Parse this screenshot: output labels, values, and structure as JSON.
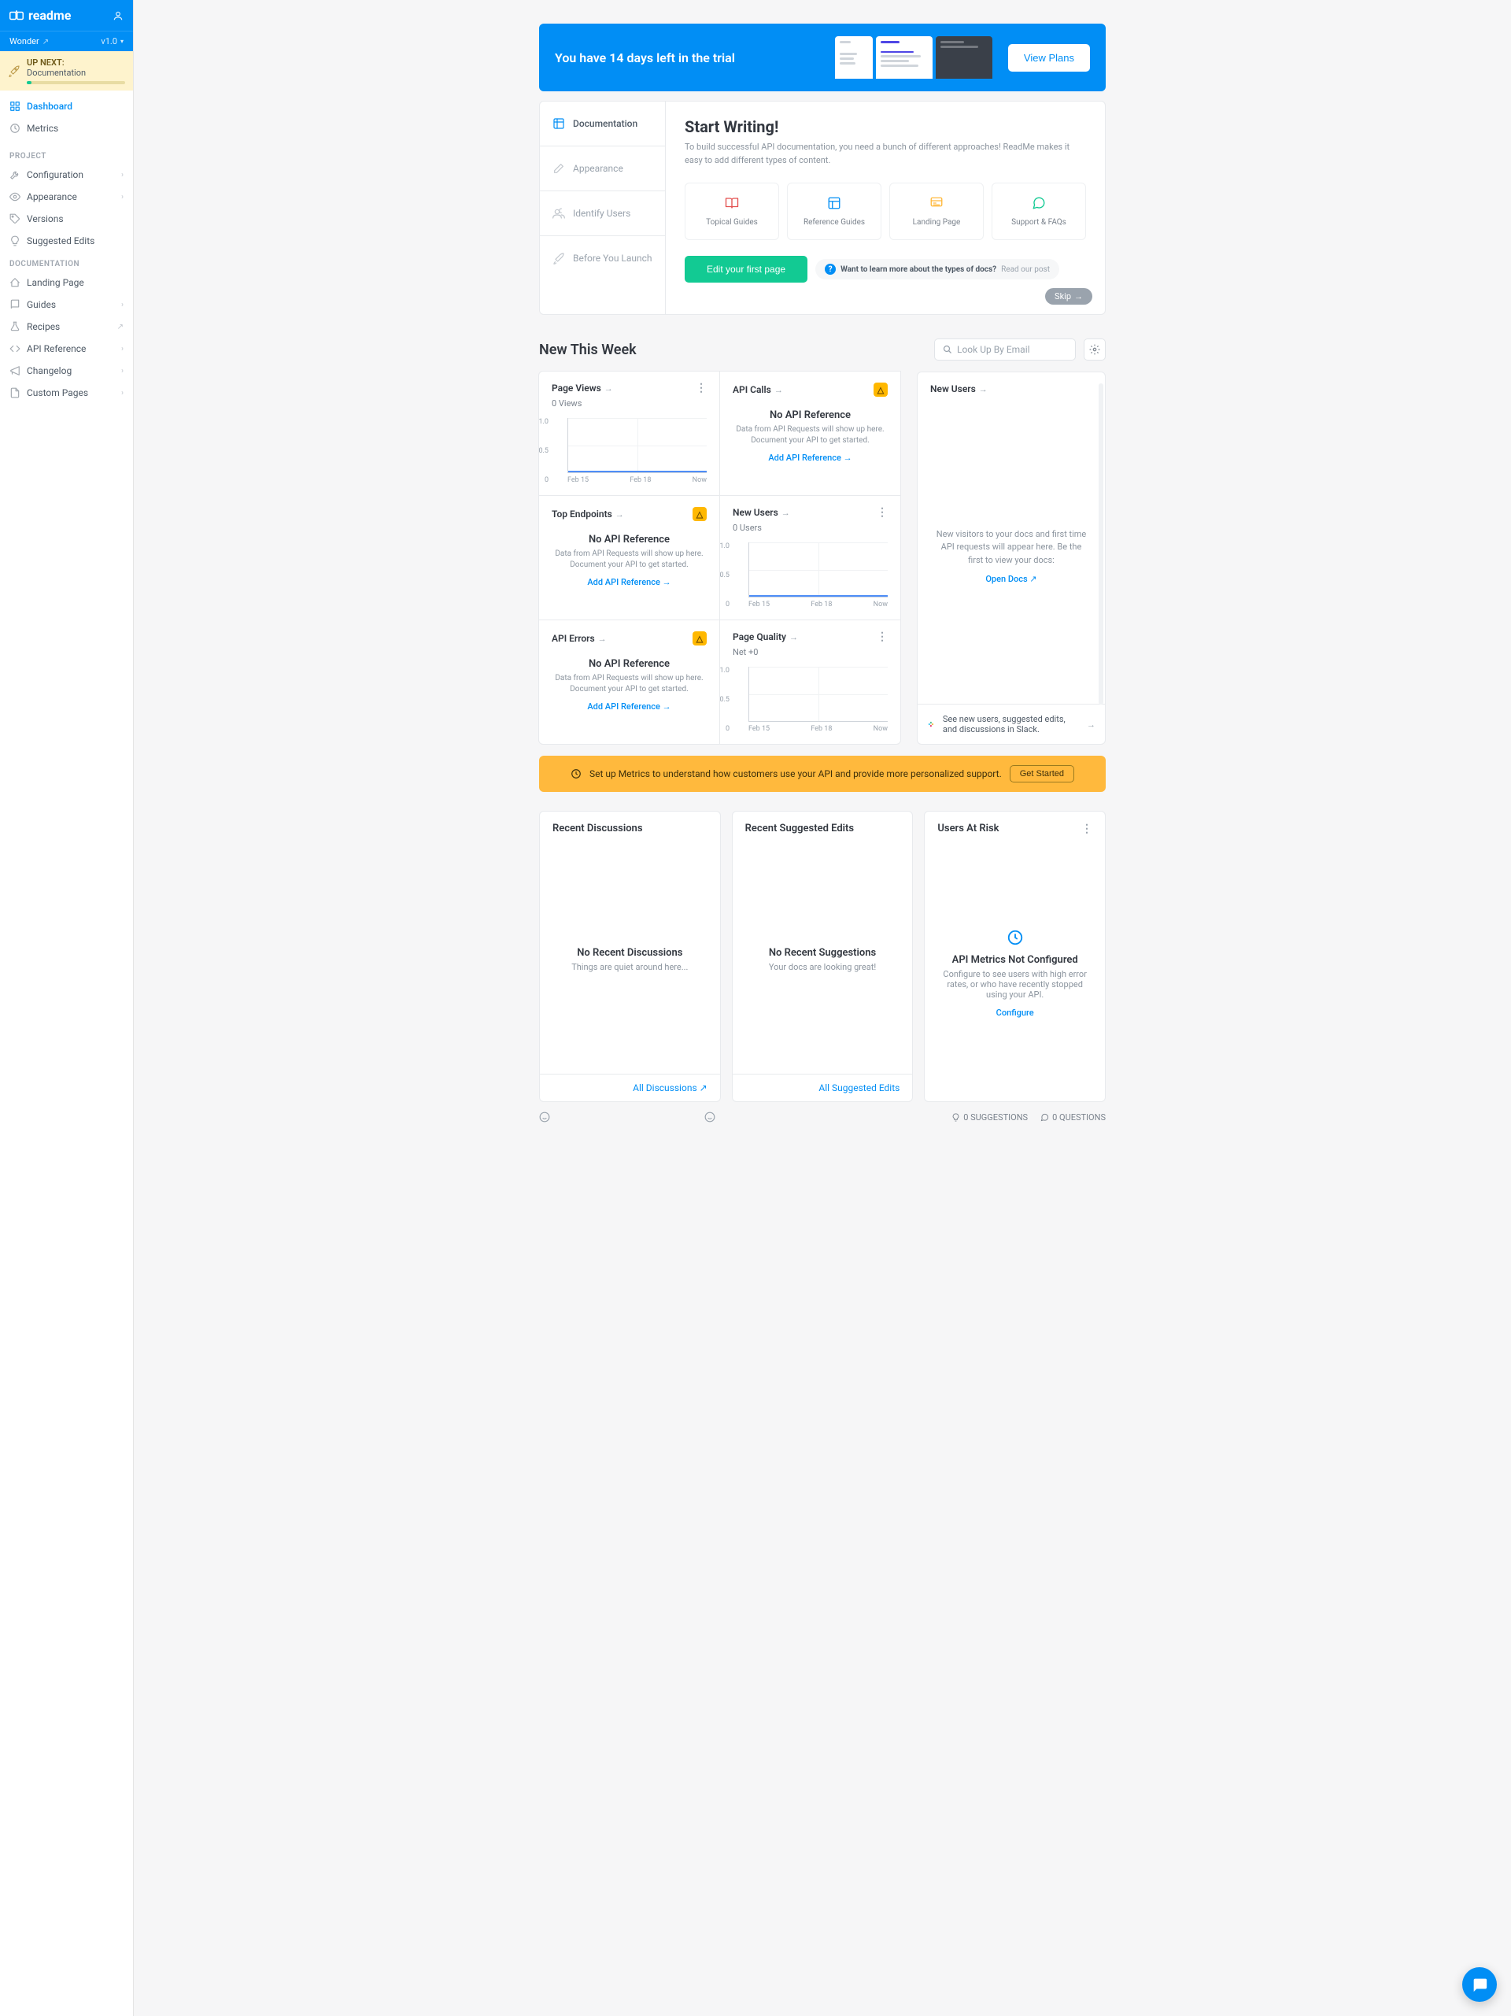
{
  "brand": "readme",
  "project": {
    "name": "Wonder",
    "version": "v1.0"
  },
  "upnext": {
    "label": "UP NEXT:",
    "value": "Documentation"
  },
  "nav": {
    "top": [
      {
        "icon": "dashboard",
        "label": "Dashboard",
        "active": true
      },
      {
        "icon": "metrics",
        "label": "Metrics"
      }
    ],
    "sections": [
      {
        "label": "PROJECT",
        "items": [
          {
            "icon": "wrench",
            "label": "Configuration",
            "chev": true
          },
          {
            "icon": "eye",
            "label": "Appearance",
            "chev": true
          },
          {
            "icon": "tag",
            "label": "Versions"
          },
          {
            "icon": "bulb",
            "label": "Suggested Edits"
          }
        ]
      },
      {
        "label": "DOCUMENTATION",
        "items": [
          {
            "icon": "home",
            "label": "Landing Page"
          },
          {
            "icon": "book",
            "label": "Guides",
            "chev": true
          },
          {
            "icon": "flask",
            "label": "Recipes",
            "ext": true
          },
          {
            "icon": "code",
            "label": "API Reference",
            "chev": true
          },
          {
            "icon": "mega",
            "label": "Changelog",
            "chev": true
          },
          {
            "icon": "file",
            "label": "Custom Pages",
            "chev": true
          }
        ]
      }
    ]
  },
  "trial": {
    "msg": "You have 14 days left in the trial",
    "btn": "View Plans"
  },
  "onboard": {
    "tabs": [
      "Documentation",
      "Appearance",
      "Identify Users",
      "Before You Launch"
    ],
    "title": "Start Writing!",
    "desc": "To build successful API documentation, you need a bunch of different approaches! ReadMe makes it easy to add different types of content.",
    "cards": [
      {
        "icon": "bookopen",
        "label": "Topical Guides",
        "color": "#e3504f"
      },
      {
        "icon": "layout",
        "label": "Reference Guides",
        "color": "#018ef5"
      },
      {
        "icon": "landing",
        "label": "Landing Page",
        "color": "#ffb93d"
      },
      {
        "icon": "chat",
        "label": "Support & FAQs",
        "color": "#12ca93"
      }
    ],
    "primary_btn": "Edit your first page",
    "help": {
      "q": "Want to learn more about the types of docs?",
      "a": "Read our post"
    },
    "skip": "Skip"
  },
  "week": {
    "title": "New This Week",
    "search_placeholder": "Look Up By Email"
  },
  "widgets": {
    "page_views": {
      "title": "Page Views",
      "sub": "0 Views"
    },
    "api_calls": {
      "title": "API Calls"
    },
    "top_endpoints": {
      "title": "Top Endpoints"
    },
    "new_users_small": {
      "title": "New Users",
      "sub": "0 Users"
    },
    "api_errors": {
      "title": "API Errors"
    },
    "page_quality": {
      "title": "Page Quality",
      "sub": "Net +0"
    },
    "noref": {
      "title": "No API Reference",
      "desc": "Data from API Requests will show up here. Document your API to get started.",
      "link": "Add API Reference"
    },
    "new_users_panel": {
      "title": "New Users",
      "desc": "New visitors to your docs and first time API requests will appear here. Be the first to view your docs:",
      "link": "Open Docs"
    },
    "slack": "See new users, suggested edits, and discussions in Slack."
  },
  "chart_data": [
    {
      "type": "line",
      "widget": "page_views",
      "x": [
        "Feb 15",
        "Feb 18",
        "Now"
      ],
      "yticks": [
        "0",
        "0.5",
        "1.0"
      ],
      "values": [
        0,
        0,
        0
      ],
      "ylim": [
        0,
        1
      ]
    },
    {
      "type": "line",
      "widget": "new_users_small",
      "x": [
        "Feb 15",
        "Feb 18",
        "Now"
      ],
      "yticks": [
        "0",
        "0.5",
        "1.0"
      ],
      "values": [
        0,
        0,
        0
      ],
      "ylim": [
        0,
        1
      ]
    },
    {
      "type": "line",
      "widget": "page_quality",
      "x": [
        "Feb 15",
        "Feb 18",
        "Now"
      ],
      "yticks": [
        "0",
        "0.5",
        "1.0"
      ],
      "values": [
        0,
        0,
        0
      ],
      "ylim": [
        0,
        1
      ]
    }
  ],
  "metrics_banner": {
    "text": "Set up Metrics to understand how customers use your API and provide more personalized support.",
    "btn": "Get Started"
  },
  "panels": {
    "discussions": {
      "title": "Recent Discussions",
      "empty_title": "No Recent Discussions",
      "empty_sub": "Things are quiet around here...",
      "foot": "All Discussions"
    },
    "suggested": {
      "title": "Recent Suggested Edits",
      "empty_title": "No Recent Suggestions",
      "empty_sub": "Your docs are looking great!",
      "foot": "All Suggested Edits"
    },
    "risk": {
      "title": "Users At Risk",
      "empty_title": "API Metrics Not Configured",
      "empty_sub": "Configure to see users with high error rates, or who have recently stopped using your API.",
      "link": "Configure"
    }
  },
  "footer": {
    "suggestions": "0 SUGGESTIONS",
    "questions": "0 QUESTIONS"
  }
}
